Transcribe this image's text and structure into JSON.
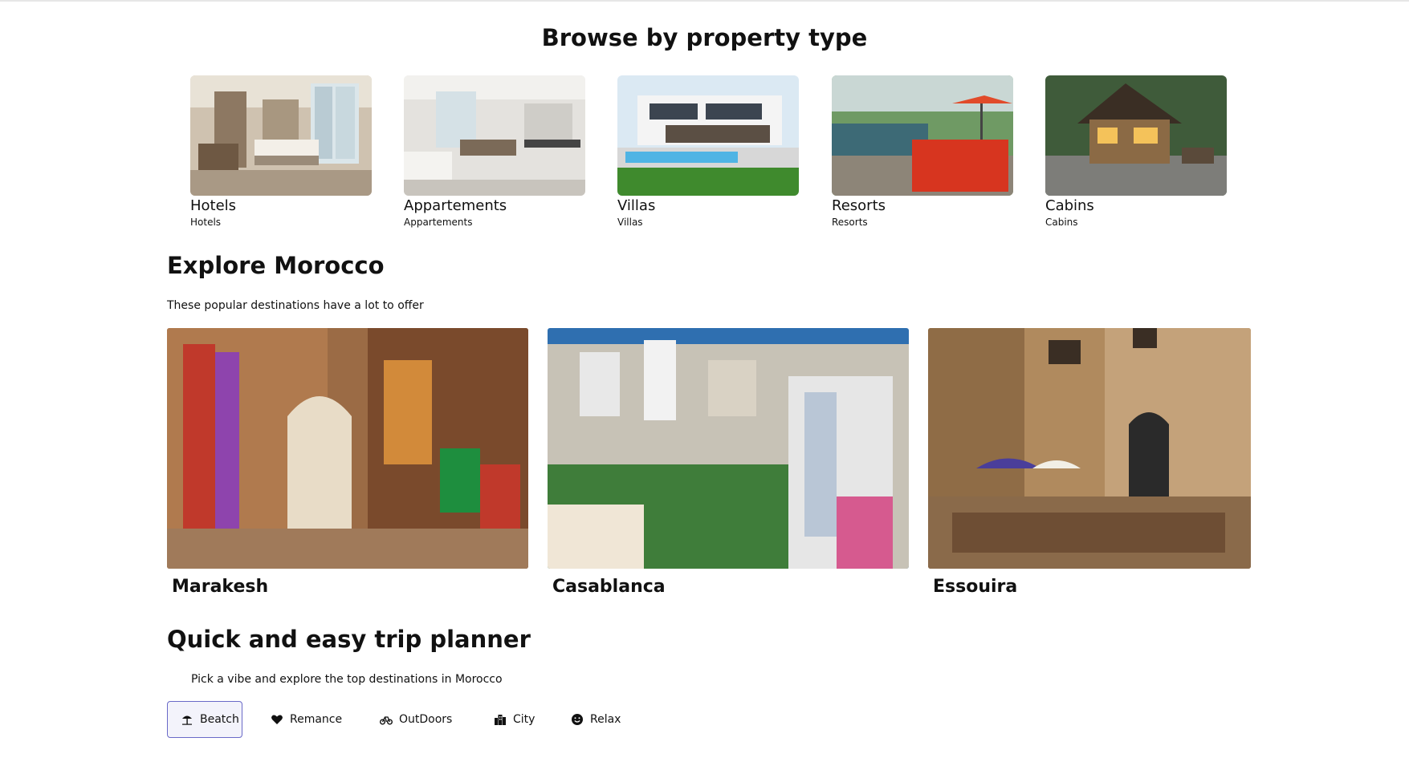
{
  "browse": {
    "title": "Browse by property type",
    "items": [
      {
        "name": "Hotels",
        "sub": "Hotels"
      },
      {
        "name": "Appartements",
        "sub": "Appartements"
      },
      {
        "name": "Villas",
        "sub": "Villas"
      },
      {
        "name": "Resorts",
        "sub": "Resorts"
      },
      {
        "name": "Cabins",
        "sub": "Cabins"
      }
    ]
  },
  "explore": {
    "title": "Explore Morocco",
    "subtitle": "These popular destinations have a lot to offer",
    "cities": [
      {
        "name": "Marakesh"
      },
      {
        "name": "Casablanca"
      },
      {
        "name": "Essouira"
      }
    ]
  },
  "planner": {
    "title": "Quick and easy trip planner",
    "subtitle": "Pick a vibe and explore the top destinations in Morocco",
    "vibes": [
      {
        "label": "Beatch",
        "icon": "beach-umbrella-icon",
        "active": true
      },
      {
        "label": "Remance",
        "icon": "heart-icon",
        "active": false
      },
      {
        "label": "OutDoors",
        "icon": "bicycle-icon",
        "active": false
      },
      {
        "label": "City",
        "icon": "city-icon",
        "active": false
      },
      {
        "label": "Relax",
        "icon": "smile-icon",
        "active": false
      }
    ]
  },
  "colors": {
    "accent": "#6a6ac8",
    "text": "#111111"
  }
}
